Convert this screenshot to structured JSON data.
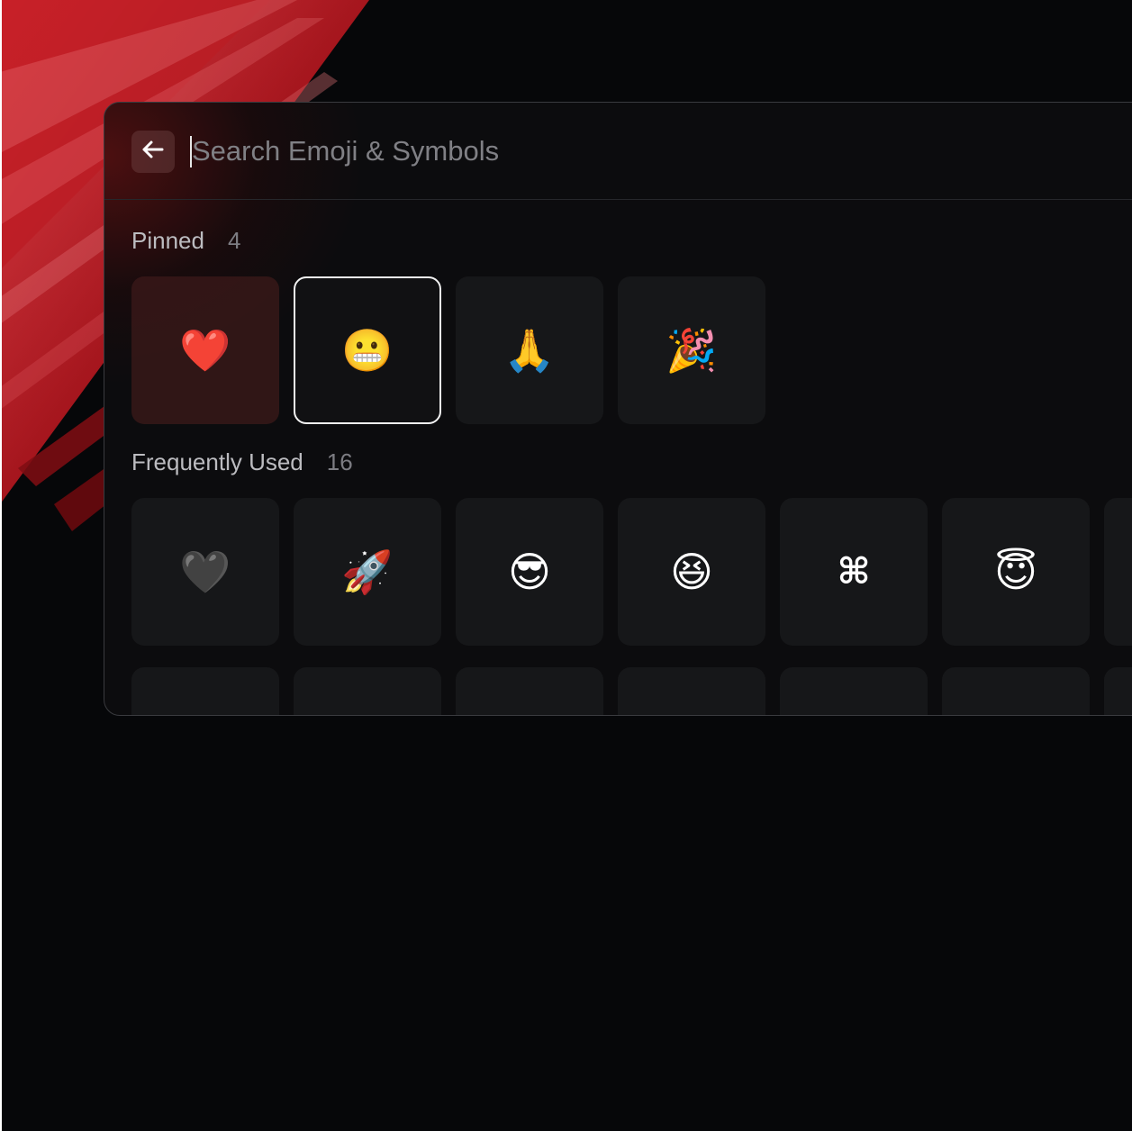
{
  "search": {
    "placeholder": "Search Emoji & Symbols",
    "value": ""
  },
  "sections": {
    "pinned": {
      "title": "Pinned",
      "count": "4",
      "items": [
        {
          "glyph": "❤️",
          "name": "red heart",
          "selected": false
        },
        {
          "glyph": "😬",
          "name": "grimacing face",
          "selected": true
        },
        {
          "glyph": "🙏",
          "name": "folded hands",
          "selected": false
        },
        {
          "glyph": "🎉",
          "name": "party popper",
          "selected": false
        }
      ]
    },
    "frequent": {
      "title": "Frequently Used",
      "count": "16",
      "items": [
        {
          "glyph": "🖤",
          "name": "black heart"
        },
        {
          "glyph": "🚀",
          "name": "rocket"
        },
        {
          "glyph": "😎",
          "name": "smiling face with sunglasses"
        },
        {
          "glyph": "😆",
          "name": "grinning squinting face"
        },
        {
          "glyph": "⌘",
          "name": "command key symbol"
        },
        {
          "glyph": "😇",
          "name": "smiling face with halo"
        }
      ]
    }
  },
  "colors": {
    "background": "#060709",
    "window": "#0c0c0e",
    "tile": "#161719",
    "accent_red": "#c0141c"
  },
  "icons": {
    "back": "arrow-left-icon"
  }
}
